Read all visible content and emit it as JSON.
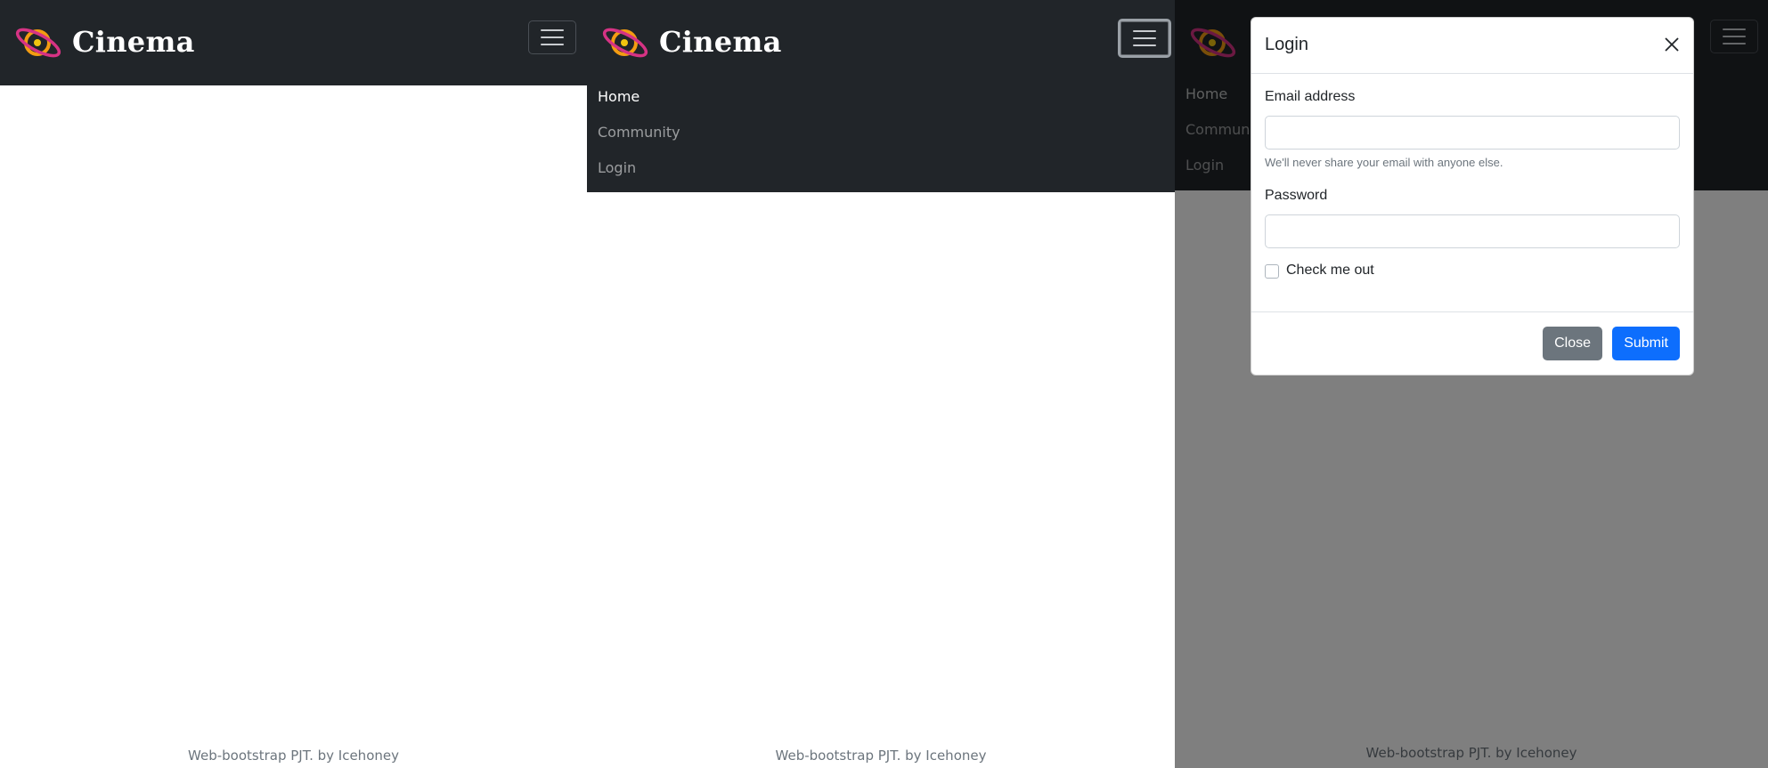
{
  "brand": {
    "name": "Cinema",
    "logo_icon": "planet-logo-icon",
    "colors": {
      "navbar": "#212529",
      "logo_pink": "#d63384",
      "logo_orange": "#f39c12",
      "logo_yellow": "#f1c40f"
    }
  },
  "navbar": {
    "toggler_icon": "hamburger-menu-icon"
  },
  "menu": {
    "items": [
      {
        "label": "Home",
        "active": true
      },
      {
        "label": "Community",
        "active": false
      },
      {
        "label": "Login",
        "active": false
      }
    ]
  },
  "footer": {
    "text": "Web-bootstrap PJT. by Icehoney"
  },
  "modal": {
    "title": "Login",
    "close_icon": "close-icon",
    "email_label": "Email address",
    "email_value": "",
    "email_help": "We'll never share your email with anyone else.",
    "password_label": "Password",
    "password_value": "",
    "checkbox_label": "Check me out",
    "checkbox_checked": false,
    "close_button": "Close",
    "submit_button": "Submit",
    "colors": {
      "primary": "#0d6efd",
      "secondary": "#6c757d",
      "backdrop": "rgba(0,0,0,0.5)"
    }
  },
  "background_menu": {
    "items": [
      {
        "label": "Home"
      },
      {
        "label": "Communit"
      },
      {
        "label": "Login"
      }
    ]
  }
}
